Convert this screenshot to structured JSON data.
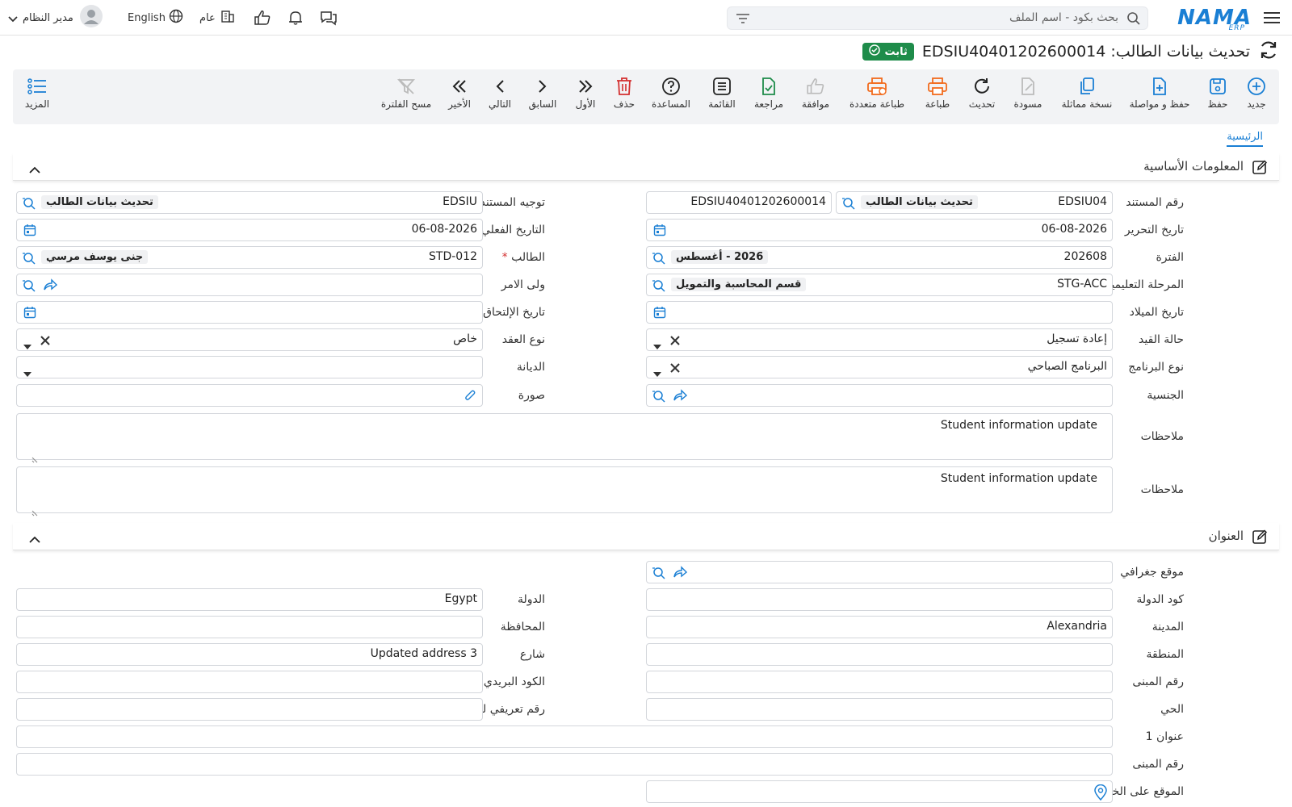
{
  "topbar": {
    "search_placeholder": "بحث بكود - اسم الملف",
    "logo": "NAMA",
    "logo_sub": "ERP",
    "user": "مدير النظام",
    "language": "English",
    "branch": "عام"
  },
  "title": {
    "text": "تحديث بيانات الطالب: EDSIU40401202600014",
    "status": "ثابت"
  },
  "toolbar": {
    "new": "جديد",
    "save": "حفظ",
    "save_continue": "حفظ و مواصلة",
    "copy": "نسخة مماثلة",
    "draft": "مسودة",
    "refresh": "تحديث",
    "print": "طباعة",
    "multi_print": "طباعة متعددة",
    "approve": "موافقة",
    "review": "مراجعة",
    "list": "القائمة",
    "help": "المساعدة",
    "delete": "حذف",
    "first": "الأول",
    "prev": "السابق",
    "next": "التالي",
    "last": "الأخير",
    "clear_filter": "مسح الفلترة",
    "more": "المزيد"
  },
  "tabs": {
    "main": "الرئيسية"
  },
  "basic": {
    "title": "المعلومات الأساسية",
    "doc_no_label": "رقم المستند",
    "doc_no_code": "EDSIU04",
    "doc_no_chip": "تحديث بيانات الطالب",
    "doc_no_full": "EDSIU40401202600014",
    "doc_dir_label": "توجيه المستند",
    "doc_dir_code": "EDSIU",
    "doc_dir_chip": "تحديث بيانات الطالب",
    "edit_date_label": "تاريخ التحرير",
    "edit_date": "06-08-2026",
    "actual_date_label": "التاريخ الفعلي",
    "actual_date": "06-08-2026",
    "period_label": "الفترة",
    "period_code": "202608",
    "period_chip": "2026 - أغسطس",
    "student_label": "الطالب",
    "student_code": "STD-012",
    "student_chip": "جنى يوسف مرسي",
    "stage_label": "المرحلة التعليمية",
    "stage_code": "STG-ACC",
    "stage_chip": "قسم المحاسبة والتمويل",
    "guardian_label": "ولى الامر",
    "birth_label": "تاريخ الميلاد",
    "join_label": "تاريخ الإلتحاق",
    "reg_status_label": "حالة القيد",
    "reg_status": "إعادة تسجيل",
    "contract_label": "نوع العقد",
    "contract": "خاص",
    "program_label": "نوع البرنامج",
    "program": "البرنامج الصباحي",
    "religion_label": "الديانة",
    "nationality_label": "الجنسية",
    "photo_label": "صورة",
    "notes_label": "ملاحظات",
    "notes": "Student information update",
    "notes2_label": "ملاحظات",
    "notes2": "Student information update"
  },
  "address": {
    "title": "العنوان",
    "geo_label": "موقع جغرافي",
    "country_code_label": "كود الدولة",
    "country_label": "الدولة",
    "country": "Egypt",
    "city_label": "المدينة",
    "city": "Alexandria",
    "governorate_label": "المحافظة",
    "region_label": "المنطقة",
    "street_label": "شارع",
    "street": "Updated address 3",
    "building_label": "رقم المبنى",
    "postal_label": "الكود البريدي",
    "district_label": "الحي",
    "land_id_label": "رقم تعريفي للأرض",
    "address1_label": "عنوان 1",
    "building2_label": "رقم المبنى",
    "map_label": "الموقع على الخريطة"
  },
  "colors": {
    "accent": "#1a7fd4",
    "success": "#1e8c4a",
    "danger": "#d32f2f",
    "orange": "#f26b1d"
  }
}
